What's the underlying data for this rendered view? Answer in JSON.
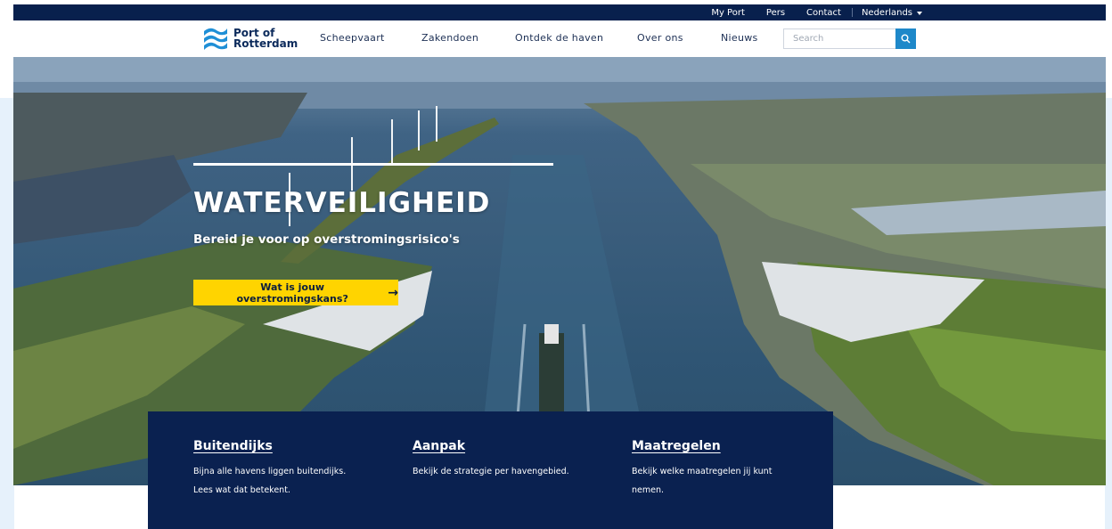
{
  "topbar": {
    "links": [
      "My Port",
      "Pers",
      "Contact"
    ],
    "language": "Nederlands"
  },
  "logo": {
    "line1": "Port of",
    "line2": "Rotterdam"
  },
  "nav": {
    "items": [
      "Scheepvaart",
      "Zakendoen",
      "Ontdek de haven",
      "Over ons",
      "Nieuws"
    ]
  },
  "search": {
    "placeholder": "Search"
  },
  "hero": {
    "title": "WATERVEILIGHEID",
    "subtitle": "Bereid je voor op overstromingsrisico's",
    "cta_label": "Wat is jouw overstromingskans?"
  },
  "info": [
    {
      "title": "Buitendijks",
      "desc": "Bijna alle havens liggen buitendijks. Lees wat dat betekent."
    },
    {
      "title": "Aanpak",
      "desc": "Bekijk de strategie per havengebied."
    },
    {
      "title": "Maatregelen",
      "desc": "Bekijk welke maatregelen jij kunt nemen."
    }
  ],
  "colors": {
    "navy": "#08204d",
    "panel": "#0a2150",
    "accent_yellow": "#ffd400",
    "search_blue": "#1e88c9"
  }
}
